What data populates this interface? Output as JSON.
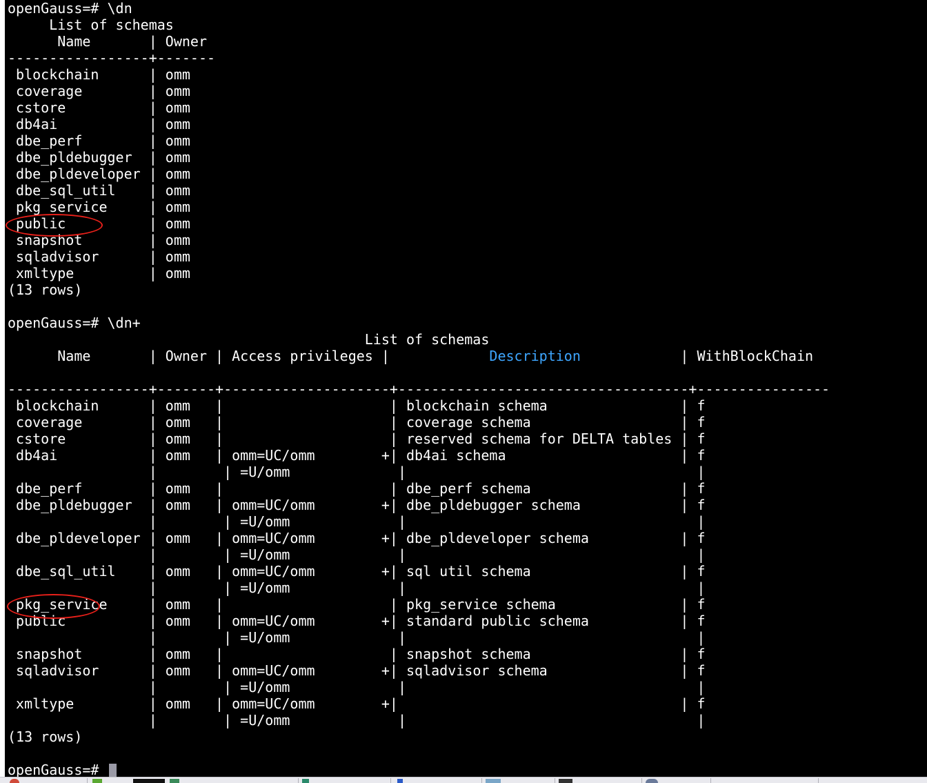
{
  "terminal": {
    "prompt": "openGauss=# ",
    "session1": {
      "command": "\\dn",
      "title": "List of schemas",
      "header": {
        "name": "Name",
        "owner": "Owner"
      },
      "separator": "-----------------+-------",
      "rows": [
        {
          "name": "blockchain",
          "owner": "omm"
        },
        {
          "name": "coverage",
          "owner": "omm"
        },
        {
          "name": "cstore",
          "owner": "omm"
        },
        {
          "name": "db4ai",
          "owner": "omm"
        },
        {
          "name": "dbe_perf",
          "owner": "omm"
        },
        {
          "name": "dbe_pldebugger",
          "owner": "omm"
        },
        {
          "name": "dbe_pldeveloper",
          "owner": "omm"
        },
        {
          "name": "dbe_sql_util",
          "owner": "omm"
        },
        {
          "name": "pkg_service",
          "owner": "omm"
        },
        {
          "name": "public",
          "owner": "omm"
        },
        {
          "name": "snapshot",
          "owner": "omm"
        },
        {
          "name": "sqladvisor",
          "owner": "omm"
        },
        {
          "name": "xmltype",
          "owner": "omm"
        }
      ],
      "row_count": "(13 rows)"
    },
    "session2": {
      "command": "\\dn+",
      "title": "List of schemas",
      "header": {
        "name": "Name",
        "owner": "Owner",
        "access": "Access privileges",
        "description": "Description",
        "withblockchain": "WithBlockChain"
      },
      "separator": "-----------------+-------+--------------------+-----------------------------------+----------------",
      "rows": [
        {
          "name": "blockchain",
          "owner": "omm",
          "access": "",
          "description": "blockchain schema",
          "wbc": "f"
        },
        {
          "name": "coverage",
          "owner": "omm",
          "access": "",
          "description": "coverage schema",
          "wbc": "f"
        },
        {
          "name": "cstore",
          "owner": "omm",
          "access": "",
          "description": "reserved schema for DELTA tables",
          "wbc": "f"
        },
        {
          "name": "db4ai",
          "owner": "omm",
          "access": "omm=UC/omm",
          "access_cont": "=U/omm",
          "description": "db4ai schema",
          "wbc": "f"
        },
        {
          "name": "dbe_perf",
          "owner": "omm",
          "access": "",
          "description": "dbe_perf schema",
          "wbc": "f"
        },
        {
          "name": "dbe_pldebugger",
          "owner": "omm",
          "access": "omm=UC/omm",
          "access_cont": "=U/omm",
          "description": "dbe_pldebugger schema",
          "wbc": "f"
        },
        {
          "name": "dbe_pldeveloper",
          "owner": "omm",
          "access": "omm=UC/omm",
          "access_cont": "=U/omm",
          "description": "dbe_pldeveloper schema",
          "wbc": "f"
        },
        {
          "name": "dbe_sql_util",
          "owner": "omm",
          "access": "omm=UC/omm",
          "access_cont": "=U/omm",
          "description": "sql util schema",
          "wbc": "f"
        },
        {
          "name": "pkg_service",
          "owner": "omm",
          "access": "",
          "description": "pkg_service schema",
          "wbc": "f"
        },
        {
          "name": "public",
          "owner": "omm",
          "access": "omm=UC/omm",
          "access_cont": "=U/omm",
          "description": "standard public schema",
          "wbc": "f"
        },
        {
          "name": "snapshot",
          "owner": "omm",
          "access": "",
          "description": "snapshot schema",
          "wbc": "f"
        },
        {
          "name": "sqladvisor",
          "owner": "omm",
          "access": "omm=UC/omm",
          "access_cont": "=U/omm",
          "description": "sqladvisor schema",
          "wbc": "f"
        },
        {
          "name": "xmltype",
          "owner": "omm",
          "access": "omm=UC/omm",
          "access_cont": "=U/omm",
          "description": "",
          "wbc": "f"
        }
      ],
      "row_count": "(13 rows)"
    },
    "final_prompt": "openGauss=# "
  },
  "annotations": {
    "circle_color": "#e8201a",
    "circled_items": [
      "public",
      "public"
    ]
  },
  "colors": {
    "background": "#000000",
    "text": "#ffffff",
    "description_header": "#3ea6ff",
    "cursor": "#9a9aa6"
  }
}
